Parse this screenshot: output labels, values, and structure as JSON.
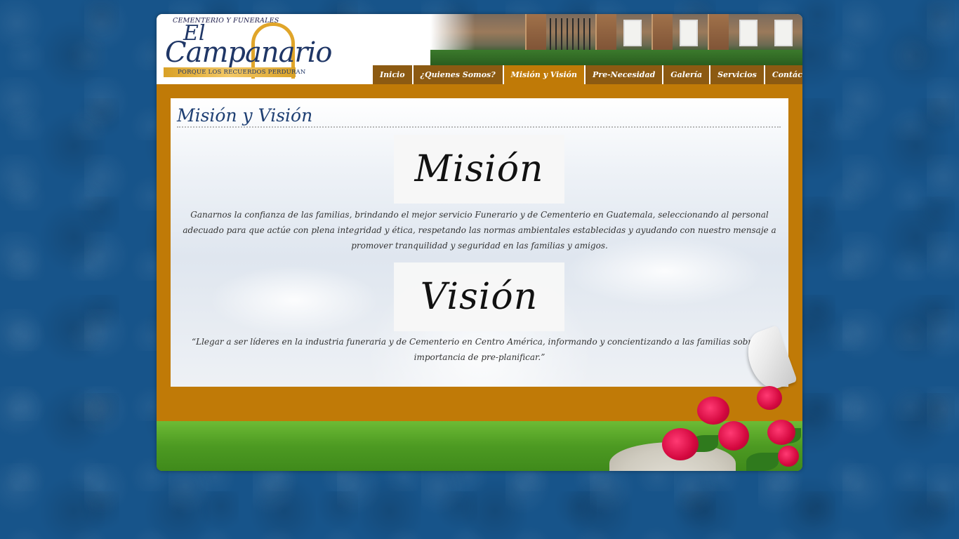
{
  "brand": {
    "top_text": "CEMENTERIO Y FUNERALES",
    "name_prefix": "El",
    "name": "Campanario",
    "slogan": "PORQUE LOS RECUERDOS PERDURAN"
  },
  "nav": {
    "items": [
      {
        "label": "Inicio"
      },
      {
        "label": "¿Quienes Somos?"
      },
      {
        "label": "Misión y Visión"
      },
      {
        "label": "Pre-Necesidad"
      },
      {
        "label": "Galería"
      },
      {
        "label": "Servicios"
      },
      {
        "label": "Contáctenos"
      }
    ],
    "active": "Misión y Visión"
  },
  "main": {
    "title": "Misión y Visión",
    "mision_heading": "Misión",
    "mision_text": "Ganarnos la confianza de las familias, brindando el mejor servicio Funerario y de Cementerio en Guatemala, seleccionando al personal adecuado para que actúe con plena integridad y ética, respetando las normas ambientales establecidas y ayudando con nuestro mensaje a promover tranquilidad y seguridad en las familias y amigos.",
    "vision_heading": "Visión",
    "vision_text": "“Llegar a ser líderes en la industria funeraria y de Cementerio en Centro América, informando y concientizando a las familias sobre la importancia de pre-planificar.”"
  },
  "colors": {
    "background": "#17548a",
    "frame": "#c07a07",
    "nav": "#8c5a12",
    "title": "#1e3f73",
    "gold": "#e0a52a"
  }
}
